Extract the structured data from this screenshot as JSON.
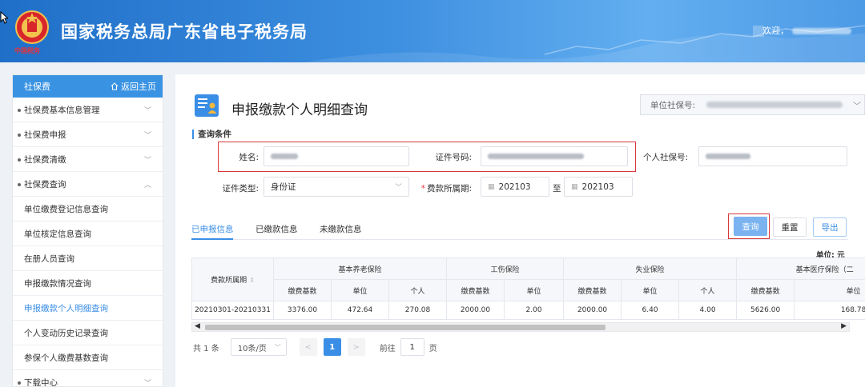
{
  "header": {
    "site_title": "国家税务总局广东省电子税务局",
    "welcome": "欢迎，",
    "emblem_caption": "中国税务"
  },
  "sidebar": {
    "section": "社保费",
    "home_link": "返回主页",
    "items": [
      {
        "label": "社保费基本信息管理",
        "expanded": false
      },
      {
        "label": "社保费申报",
        "expanded": false
      },
      {
        "label": "社保费清缴",
        "expanded": false
      },
      {
        "label": "社保费查询",
        "expanded": true
      }
    ],
    "sub_items": [
      {
        "label": "单位缴费登记信息查询",
        "active": false
      },
      {
        "label": "单位核定信息查询",
        "active": false
      },
      {
        "label": "在册人员查询",
        "active": false
      },
      {
        "label": "申报缴款情况查询",
        "active": false
      },
      {
        "label": "申报缴款个人明细查询",
        "active": true
      },
      {
        "label": "个人变动历史记录查询",
        "active": false
      },
      {
        "label": "参保个人缴费基数查询",
        "active": false
      }
    ],
    "last_item": "下载中心"
  },
  "page": {
    "title": "申报缴款个人明细查询",
    "unit_social_no_label": "单位社保号:",
    "condition_title": "查询条件",
    "name_label": "姓名:",
    "id_no_label": "证件号码:",
    "personal_social_no_label": "个人社保号:",
    "id_type_label": "证件类型:",
    "id_type_value": "身份证",
    "period_label": "费款所属期:",
    "period_from": "202103",
    "period_to_label": "至",
    "period_to": "202103"
  },
  "tabs": [
    "已申报信息",
    "已缴款信息",
    "未缴款信息"
  ],
  "buttons": {
    "query": "查询",
    "reset": "重置",
    "export": "导出"
  },
  "table": {
    "unit_note": "单位: 元",
    "period_header": "费款所属期",
    "groups": [
      "基本养老保险",
      "工伤保险",
      "失业保险",
      "基本医疗保险（二"
    ],
    "sub_headers": [
      "缴费基数",
      "单位",
      "个人",
      "缴费基数",
      "单位",
      "缴费基数",
      "单位",
      "个人",
      "缴费基数",
      "单位"
    ],
    "rows": [
      [
        "20210301-20210331",
        "3376.00",
        "472.64",
        "270.08",
        "2000.00",
        "2.00",
        "2000.00",
        "6.40",
        "4.00",
        "5626.00",
        "168.78"
      ]
    ]
  },
  "pager": {
    "total": "共 1 条",
    "page_size": "10条/页",
    "prev": "<",
    "current": "1",
    "next": ">",
    "goto_label": "前往",
    "goto_value": "1",
    "page_unit": "页"
  },
  "colors": {
    "brand_blue": "#3a8ee6",
    "highlight_red": "#d9383a",
    "header_blue": "#2e80d6"
  }
}
